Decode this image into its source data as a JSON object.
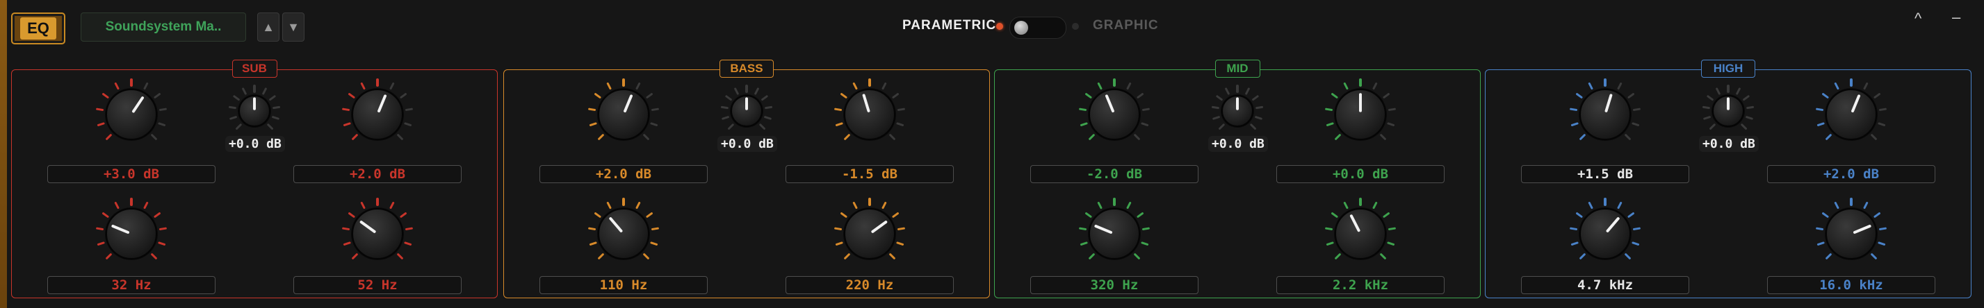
{
  "header": {
    "eq_label": "EQ",
    "preset_name": "Soundsystem Ma..",
    "up_arrow": "▲",
    "down_arrow": "▼",
    "mode_parametric": "PARAMETRIC",
    "mode_graphic": "GRAPHIC",
    "collapse_glyph": "^",
    "minimize_glyph": "–"
  },
  "colors": {
    "sub": "#c8352b",
    "bass": "#d88a2a",
    "mid": "#3ea34e",
    "high": "#4a82c8",
    "white": "#e6e6e6",
    "accent": "#c98a22"
  },
  "bands": [
    {
      "id": "sub",
      "title": "SUB",
      "gain_center": "+0.0 dB",
      "left_gain": "+3.0 dB",
      "right_gain": "+2.0 dB",
      "left_freq": "32 Hz",
      "right_freq": "52 Hz"
    },
    {
      "id": "bass",
      "title": "BASS",
      "gain_center": "+0.0 dB",
      "left_gain": "+2.0 dB",
      "right_gain": "-1.5 dB",
      "left_freq": "110 Hz",
      "right_freq": "220 Hz"
    },
    {
      "id": "mid",
      "title": "MID",
      "gain_center": "+0.0 dB",
      "left_gain": "-2.0 dB",
      "right_gain": "+0.0 dB",
      "left_freq": "320 Hz",
      "right_freq": "2.2 kHz"
    },
    {
      "id": "high",
      "title": "HIGH",
      "gain_center": "+0.0 dB",
      "left_gain": "+1.5 dB",
      "right_gain": "+2.0 dB",
      "left_freq": "4.7 kHz",
      "right_freq": "16.0 kHz"
    }
  ],
  "knob_levels": {
    "gain_range_db": [
      -12,
      12
    ],
    "sub": {
      "left_gain": 3.0,
      "right_gain": 2.0
    },
    "bass": {
      "left_gain": 2.0,
      "right_gain": -1.5
    },
    "mid": {
      "left_gain": -2.0,
      "right_gain": 0.0
    },
    "high": {
      "left_gain": 1.5,
      "right_gain": 2.0
    },
    "freq_position": {
      "sub": [
        0.25,
        0.3
      ],
      "bass": [
        0.35,
        0.7
      ],
      "mid": [
        0.25,
        0.4
      ],
      "high": [
        0.65,
        0.75
      ]
    }
  }
}
